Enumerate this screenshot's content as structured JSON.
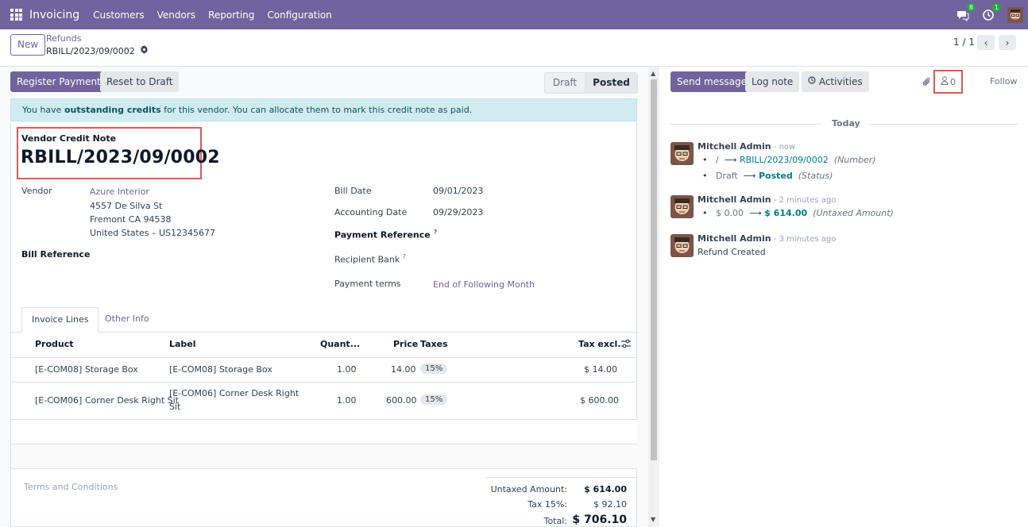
{
  "navbar": {
    "app_name": "Invoicing",
    "menu": [
      "Customers",
      "Vendors",
      "Reporting",
      "Configuration"
    ],
    "messages_count": "8",
    "activities_count": "1"
  },
  "control": {
    "new_label": "New",
    "breadcrumb_parent": "Refunds",
    "breadcrumb_current": "RBILL/2023/09/0002",
    "pager": "1 / 1"
  },
  "actions": {
    "register_payment": "Register Payment",
    "reset_to_draft": "Reset to Draft"
  },
  "status": {
    "draft": "Draft",
    "posted": "Posted"
  },
  "alert": {
    "prefix": "You have ",
    "bold": "outstanding credits",
    "suffix": " for this vendor. You can allocate them to mark this credit note as paid."
  },
  "form": {
    "doc_type": "Vendor Credit Note",
    "name": "RBILL/2023/09/0002",
    "vendor_label": "Vendor",
    "vendor_name": "Azure Interior",
    "vendor_street": "4557 De Silva St",
    "vendor_city": "Fremont CA 94538",
    "vendor_country": "United States – US12345677",
    "bill_reference_label": "Bill Reference",
    "bill_date_label": "Bill Date",
    "bill_date": "09/01/2023",
    "accounting_date_label": "Accounting Date",
    "accounting_date": "09/29/2023",
    "payment_reference_label": "Payment Reference",
    "recipient_bank_label": "Recipient Bank",
    "payment_terms_label": "Payment terms",
    "payment_terms": "End of Following Month",
    "help_mark": "?"
  },
  "tabs": {
    "invoice_lines": "Invoice Lines",
    "other_info": "Other Info"
  },
  "table": {
    "headers": {
      "product": "Product",
      "label": "Label",
      "quantity": "Quant...",
      "price": "Price",
      "taxes": "Taxes",
      "tax_excl": "Tax excl."
    },
    "rows": [
      {
        "product": "[E-COM08] Storage Box",
        "label_line1": "[E-COM08] Storage Box",
        "label_line2": "",
        "quantity": "1.00",
        "price": "14.00",
        "tax": "15%",
        "subtotal": "$ 14.00"
      },
      {
        "product": "[E-COM06] Corner Desk Right Sit",
        "label_line1": "[E-COM06] Corner Desk Right",
        "label_line2": "Sit",
        "quantity": "1.00",
        "price": "600.00",
        "tax": "15%",
        "subtotal": "$ 600.00"
      }
    ]
  },
  "totals": {
    "terms_placeholder": "Terms and Conditions",
    "untaxed_label": "Untaxed Amount:",
    "untaxed_value": "$ 614.00",
    "tax_label": "Tax 15%:",
    "tax_value": "$ 92.10",
    "total_label": "Total:",
    "total_value": "$ 706.10"
  },
  "chatter": {
    "send_message": "Send message",
    "log_note": "Log note",
    "activities": "Activities",
    "followers_count": "0",
    "follow": "Follow",
    "date_separator": "Today",
    "messages": [
      {
        "author": "Mitchell Admin",
        "time": " - now",
        "tracking": [
          {
            "old": "/",
            "new": "RBILL/2023/09/0002",
            "field": "(Number)"
          },
          {
            "old": "Draft",
            "new": "Posted",
            "field": "(Status)"
          }
        ]
      },
      {
        "author": "Mitchell Admin",
        "time": " - 2 minutes ago",
        "tracking": [
          {
            "old": "$ 0.00",
            "new": "$ 614.00",
            "field": "(Untaxed Amount)"
          }
        ]
      },
      {
        "author": "Mitchell Admin",
        "time": " - 3 minutes ago",
        "body": "Refund Created"
      }
    ]
  },
  "colors": {
    "brand": "#71639e",
    "highlight": "#e05858",
    "alert_bg": "#d1ecf1",
    "tracking_new": "#017e84"
  }
}
